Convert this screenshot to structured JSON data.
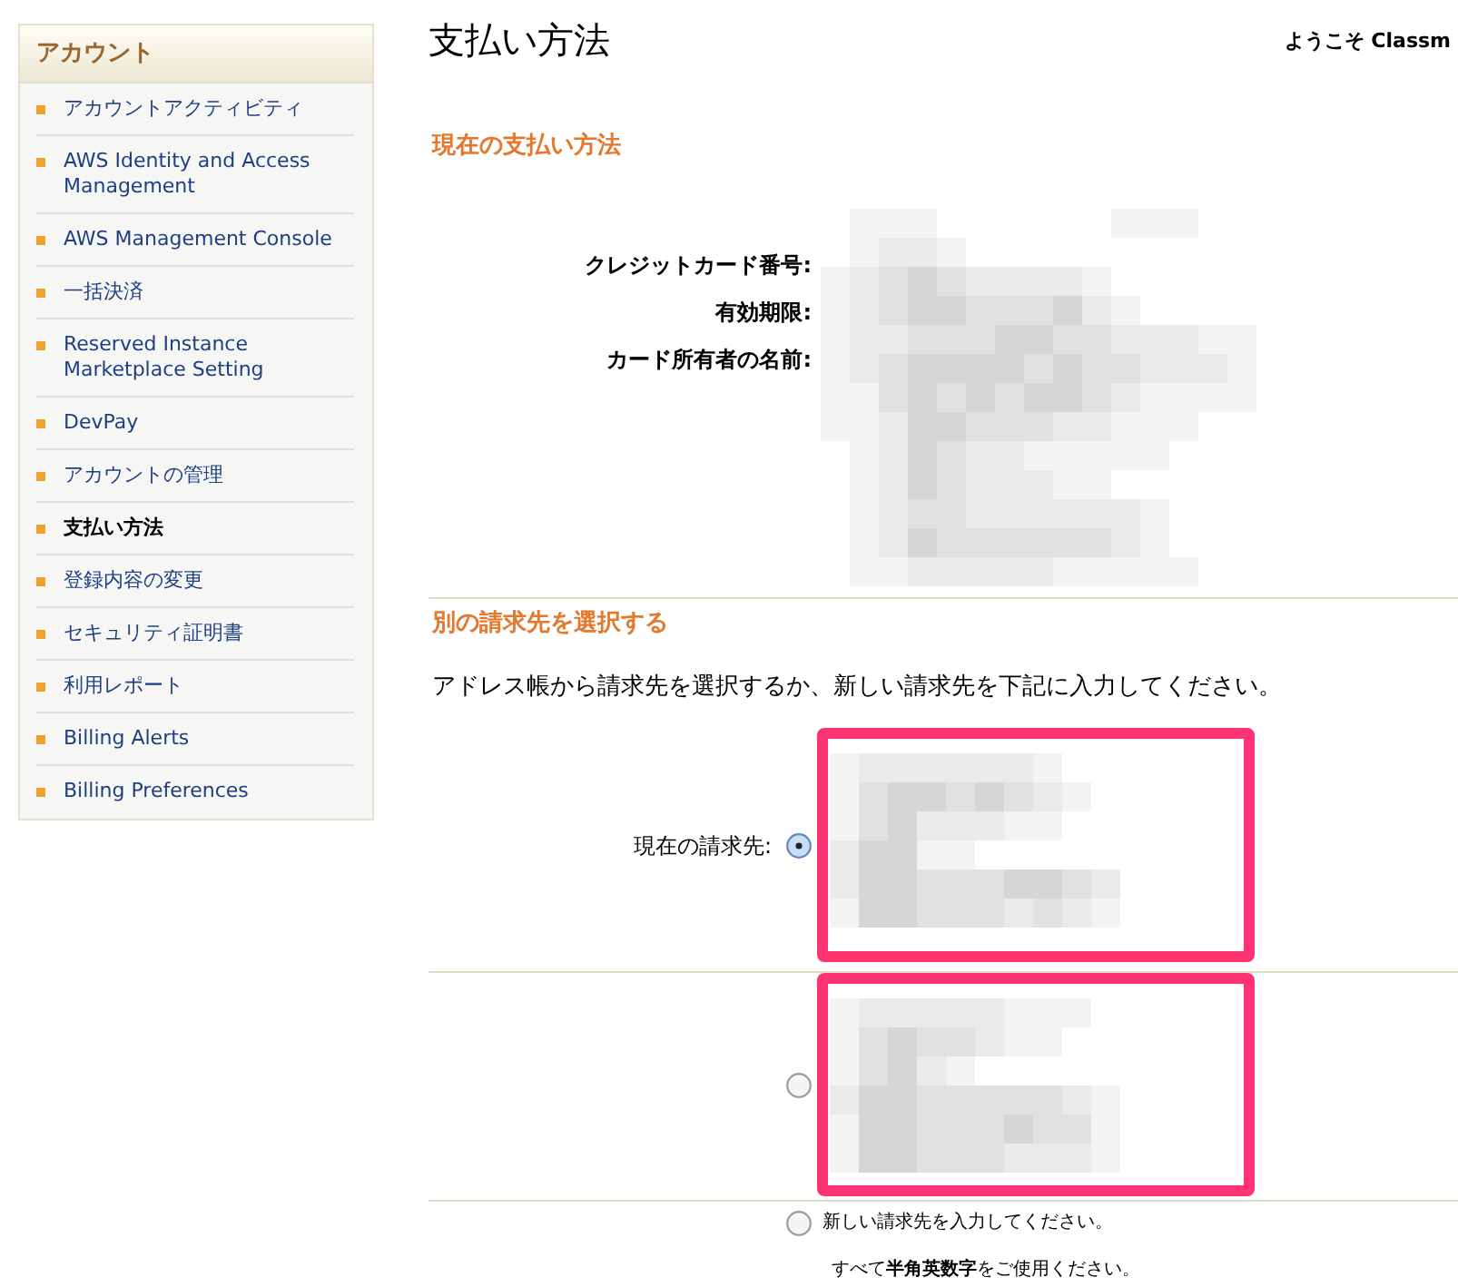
{
  "sidebar": {
    "title": "アカウント",
    "items": [
      {
        "label": "アカウントアクティビティ",
        "selected": false
      },
      {
        "label": "AWS Identity and Access Management",
        "selected": false
      },
      {
        "label": "AWS Management Console",
        "selected": false
      },
      {
        "label": "一括決済",
        "selected": false
      },
      {
        "label": "Reserved Instance Marketplace Setting",
        "selected": false
      },
      {
        "label": "DevPay",
        "selected": false
      },
      {
        "label": "アカウントの管理",
        "selected": false
      },
      {
        "label": "支払い方法",
        "selected": true
      },
      {
        "label": "登録内容の変更",
        "selected": false
      },
      {
        "label": "セキュリティ証明書",
        "selected": false
      },
      {
        "label": "利用レポート",
        "selected": false
      },
      {
        "label": "Billing Alerts",
        "selected": false
      },
      {
        "label": "Billing Preferences",
        "selected": false
      }
    ]
  },
  "header": {
    "title": "支払い方法",
    "welcome": "ようこそ Classm"
  },
  "current_payment": {
    "heading": "現在の支払い方法",
    "labels": [
      "クレジットカード番号:",
      "有効期限:",
      "カード所有者の名前:"
    ]
  },
  "billing_address": {
    "heading": "別の請求先を選択する",
    "instructions": "アドレス帳から請求先を選択するか、新しい請求先を下記に入力してください。",
    "options": [
      {
        "kind": "address",
        "label": "現在の請求先:",
        "selected": true,
        "highlighted": true
      },
      {
        "kind": "address",
        "selected": false,
        "highlighted": true
      },
      {
        "kind": "new",
        "label": "新しい請求先を入力してください。",
        "selected": false
      }
    ],
    "note": "すべて**半角英数字**をご使用ください。"
  }
}
